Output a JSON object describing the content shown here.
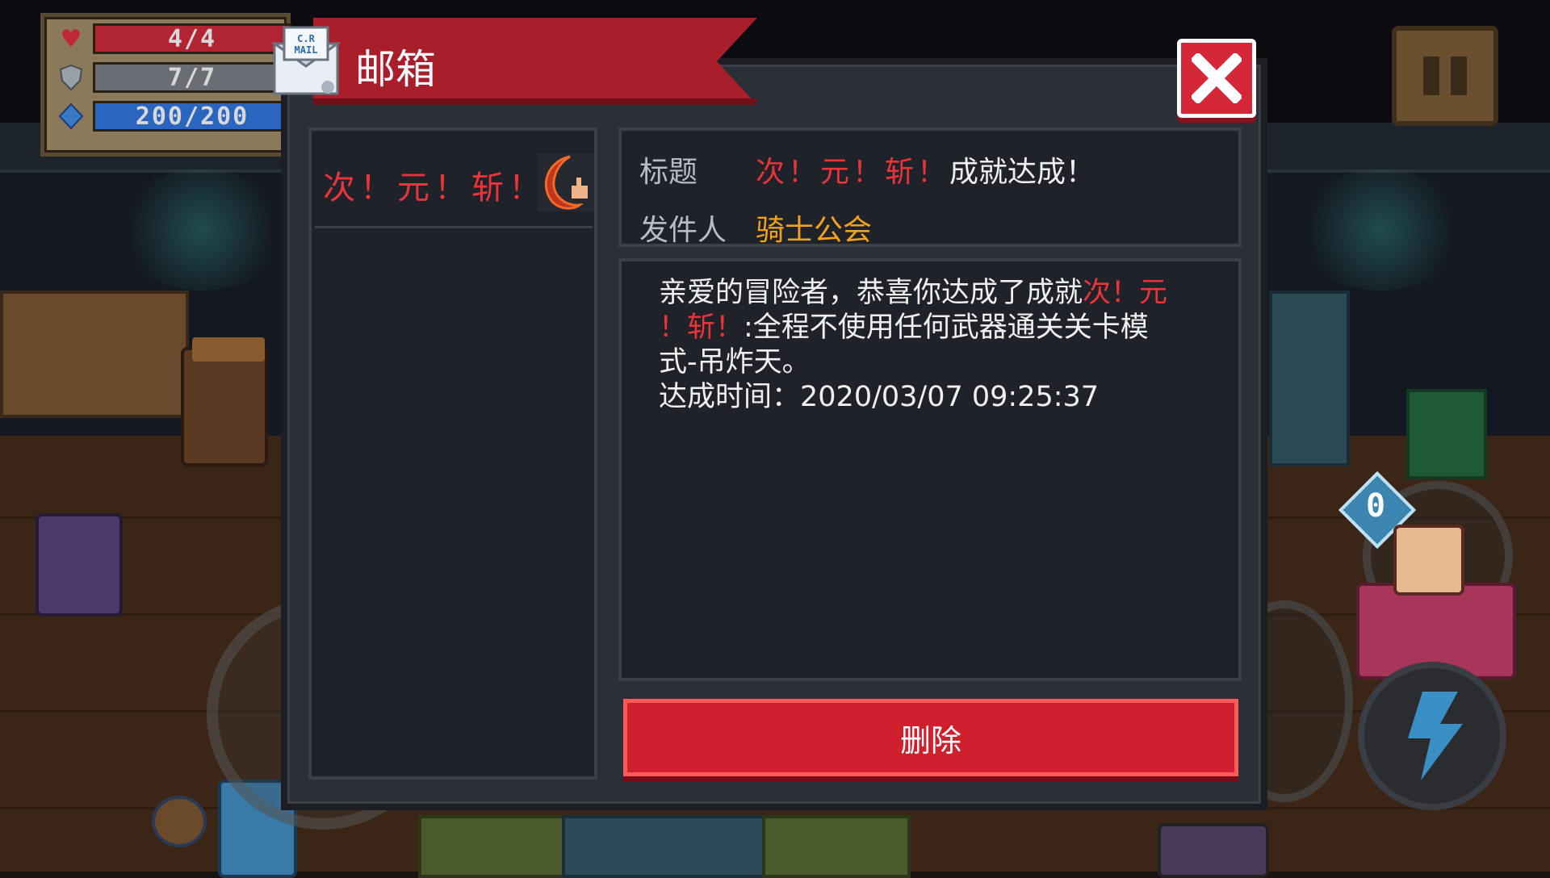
{
  "hud": {
    "hp": "4/4",
    "armor": "7/7",
    "energy": "200/200",
    "hp_icon": "heart-icon",
    "armor_icon": "shield-icon",
    "energy_icon": "diamond-icon"
  },
  "mailbox": {
    "title": "邮箱",
    "icon": "mail-icon",
    "mail_badge": "C.R MAIL",
    "close_icon": "close-icon",
    "list": [
      {
        "title": "次！元！斩！",
        "icon": "crescent-blade-icon"
      }
    ],
    "detail": {
      "subject_label": "标题",
      "subject_highlight": "次！元！斩！",
      "subject_rest": "成就达成！",
      "sender_label": "发件人",
      "sender": "骑士公会",
      "body_line1_plain": "亲爱的冒险者，恭喜你达成了成就",
      "body_line1_red": "次！元",
      "body_line2_red": "！斩！",
      "body_line2_plain": ":全程不使用任何武器通关关卡模",
      "body_line3": "式-吊炸天。",
      "body_line4_label": "达成时间：",
      "body_line4_time": "2020/03/07 09:25:37"
    },
    "delete_label": "删除"
  },
  "controls": {
    "pause_icon": "pause-icon",
    "skill_icon": "lightning-icon",
    "weapon_ammo": "0"
  },
  "colors": {
    "banner_red": "#a81e2a",
    "highlight_red": "#e8343a",
    "sender_orange": "#f3a21b",
    "delete_red": "#d0202e",
    "panel_bg": "#1f2228"
  }
}
